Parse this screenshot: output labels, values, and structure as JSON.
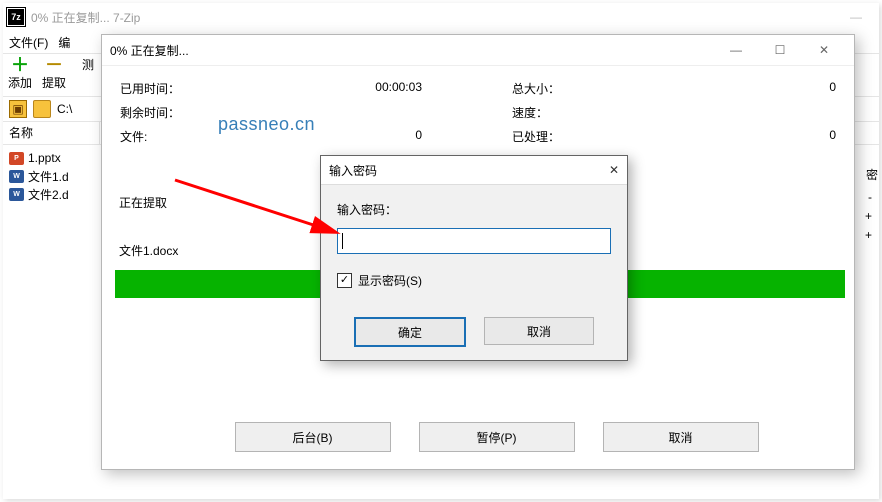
{
  "outer_window": {
    "icon_text": "7z",
    "title": "0% 正在复制... 7-Zip"
  },
  "menubar": {
    "file": "文件(F)",
    "edit": "编"
  },
  "toolbar": {
    "add": {
      "glyph": "＋",
      "label": "添加",
      "color": "#0aa30a"
    },
    "extract": {
      "glyph": "－",
      "label": "提取",
      "color": "#b58a00"
    },
    "test": {
      "glyph": "",
      "label": "测"
    }
  },
  "path_row": {
    "path": "C:\\"
  },
  "list": {
    "header_name": "名称",
    "header_encrypted": "密",
    "files": [
      {
        "icon_bg": "#d24726",
        "icon_txt": "P",
        "name": "1.pptx",
        "flag": "-"
      },
      {
        "icon_bg": "#2b579a",
        "icon_txt": "W",
        "name": "文件1.d",
        "flag": "+"
      },
      {
        "icon_bg": "#2b579a",
        "icon_txt": "W",
        "name": "文件2.d",
        "flag": "+"
      }
    ]
  },
  "progress": {
    "title": "0% 正在复制...",
    "labels": {
      "elapsed": "已用时间：",
      "remaining": "剩余时间：",
      "files": "文件:",
      "total": "总大小：",
      "speed": "速度：",
      "processed": "已处理："
    },
    "values": {
      "elapsed": "00:00:03",
      "files": "0",
      "total": "0",
      "processed": "0"
    },
    "extracting_label": "正在提取",
    "current_file": "文件1.docx",
    "buttons": {
      "background": "后台(B)",
      "pause": "暂停(P)",
      "cancel": "取消"
    }
  },
  "watermark": "passneo.cn",
  "password_dialog": {
    "title": "输入密码",
    "label": "输入密码：",
    "show_password": "显示密码(S)",
    "ok": "确定",
    "cancel": "取消",
    "value": ""
  },
  "window_buttons": {
    "min": "—",
    "max": "☐",
    "close": "✕"
  }
}
